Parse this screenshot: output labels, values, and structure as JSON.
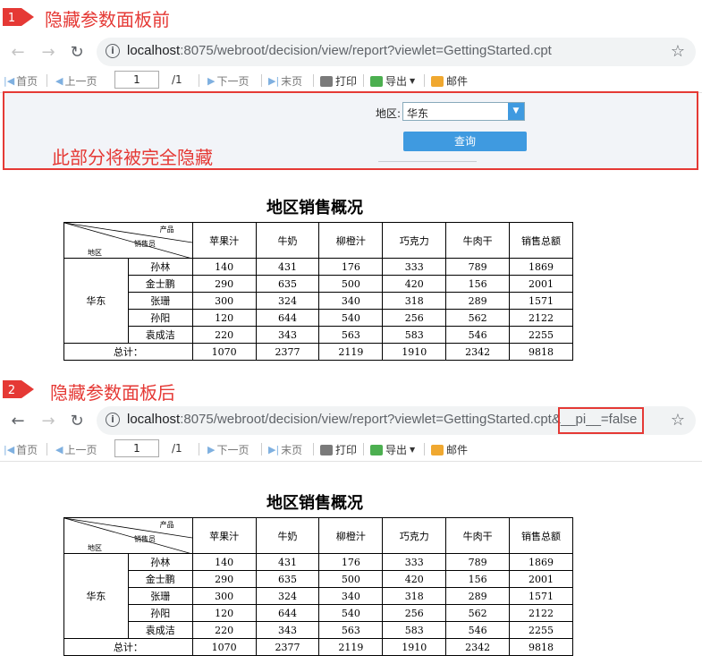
{
  "step1": {
    "number": "1",
    "title": "隐藏参数面板前"
  },
  "step2": {
    "number": "2",
    "title": "隐藏参数面板后"
  },
  "browser1": {
    "url_host": "localhost",
    "url_rest": ":8075/webroot/decision/view/report?viewlet=GettingStarted.cpt"
  },
  "browser2": {
    "url_host": "localhost",
    "url_rest": ":8075/webroot/decision/view/report?viewlet=GettingStarted.cpt",
    "url_param": "&__pi__=false"
  },
  "toolbar": {
    "first": "首页",
    "prev": "上一页",
    "page_value": "1",
    "page_total": "/1",
    "next": "下一页",
    "last": "末页",
    "print": "打印",
    "export": "导出",
    "email": "邮件"
  },
  "param_panel": {
    "region_label": "地区:",
    "region_value": "华东",
    "query_button": "查询",
    "note": "此部分将被完全隐藏"
  },
  "report": {
    "title": "地区销售概况",
    "corner": {
      "product": "产品",
      "salesperson": "销售员",
      "region": "地区"
    },
    "columns": [
      "苹果汁",
      "牛奶",
      "柳橙汁",
      "巧克力",
      "牛肉干",
      "销售总额"
    ],
    "region": "华东",
    "rows": [
      {
        "name": "孙林",
        "values": [
          "140",
          "431",
          "176",
          "333",
          "789",
          "1869"
        ]
      },
      {
        "name": "金士鹏",
        "values": [
          "290",
          "635",
          "500",
          "420",
          "156",
          "2001"
        ]
      },
      {
        "name": "张珊",
        "values": [
          "300",
          "324",
          "340",
          "318",
          "289",
          "1571"
        ]
      },
      {
        "name": "孙阳",
        "values": [
          "120",
          "644",
          "540",
          "256",
          "562",
          "2122"
        ]
      },
      {
        "name": "袁成洁",
        "values": [
          "220",
          "343",
          "563",
          "583",
          "546",
          "2255"
        ]
      }
    ],
    "total_label": "总计：",
    "totals": [
      "1070",
      "2377",
      "2119",
      "1910",
      "2342",
      "9818"
    ]
  }
}
